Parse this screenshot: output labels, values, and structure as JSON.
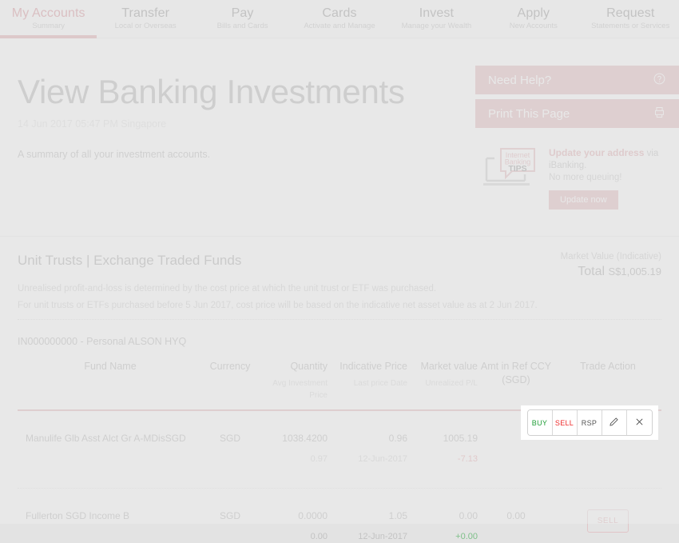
{
  "nav": {
    "items": [
      {
        "title": "My Accounts",
        "sub": "Summary",
        "active": true
      },
      {
        "title": "Transfer",
        "sub": "Local or Overseas",
        "active": false
      },
      {
        "title": "Pay",
        "sub": "Bills and Cards",
        "active": false
      },
      {
        "title": "Cards",
        "sub": "Activate and Manage",
        "active": false
      },
      {
        "title": "Invest",
        "sub": "Manage your Wealth",
        "active": false
      },
      {
        "title": "Apply",
        "sub": "New Accounts",
        "active": false
      },
      {
        "title": "Request",
        "sub": "Statements or Services",
        "active": false
      }
    ]
  },
  "hero": {
    "title": "View Banking Investments",
    "timestamp": "14 Jun 2017 05:47 PM Singapore",
    "description": "A summary of all your investment accounts."
  },
  "rail": {
    "need_help": "Need Help?",
    "print_page": "Print This Page",
    "tips": {
      "badge_line1": "Internet",
      "badge_line2": "Banking",
      "badge_line3": "TIPS",
      "headline_strong": "Update your address",
      "headline_rest": " via iBanking.",
      "subline": "No more queuing!",
      "cta": "Update now"
    }
  },
  "section": {
    "title": "Unit Trusts | Exchange Traded Funds",
    "market_value_label": "Market Value (Indicative)",
    "total_word": "Total",
    "total_value": "S$1,005.19",
    "note1": "Unrealised profit-and-loss is determined by the cost price at which the unit trust or ETF was purchased.",
    "note2": "For unit trusts or ETFs purchased before 5 Jun 2017, cost price will be based on the indicative net asset value as at 2 Jun 2017.",
    "account": "IN000000000 - Personal ALSON HYQ"
  },
  "table": {
    "headers": [
      {
        "main": "Fund Name",
        "sub": ""
      },
      {
        "main": "Currency",
        "sub": ""
      },
      {
        "main": "Quantity",
        "sub": "Avg Investment Price"
      },
      {
        "main": "Indicative Price",
        "sub": "Last price Date"
      },
      {
        "main": "Market value",
        "sub": "Unrealized P/L"
      },
      {
        "main": "Amt in Ref CCY (SGD)",
        "sub": ""
      },
      {
        "main": "Trade Action",
        "sub": ""
      }
    ],
    "rows": [
      {
        "fund_name": "Manulife Glb Asst Alct Gr A-MDisSGD",
        "currency": "SGD",
        "quantity": "1038.4200",
        "avg_investment_price": "0.97",
        "indicative_price": "0.96",
        "last_price_date": "12-Jun-2017",
        "market_value": "1005.19",
        "unrealized_pl": "-7.13",
        "pl_sign": "neg",
        "amt_ref_ccy": ""
      },
      {
        "fund_name": "Fullerton SGD Income B",
        "currency": "SGD",
        "quantity": "0.0000",
        "avg_investment_price": "0.00",
        "indicative_price": "1.05",
        "last_price_date": "12-Jun-2017",
        "market_value": "0.00",
        "unrealized_pl": "+0.00",
        "pl_sign": "pos",
        "amt_ref_ccy": "0.00",
        "sell_label": "SELL"
      }
    ]
  },
  "actions": {
    "buy": "BUY",
    "sell": "SELL",
    "rsp": "RSP",
    "edit_icon": "pencil-icon",
    "close_icon": "x-icon"
  },
  "colors": {
    "accent": "#d9a0a4",
    "buy_green": "#1f9d36",
    "sell_red": "#ee2b2b",
    "negative": "#e0868b",
    "positive": "#7fc08a"
  }
}
